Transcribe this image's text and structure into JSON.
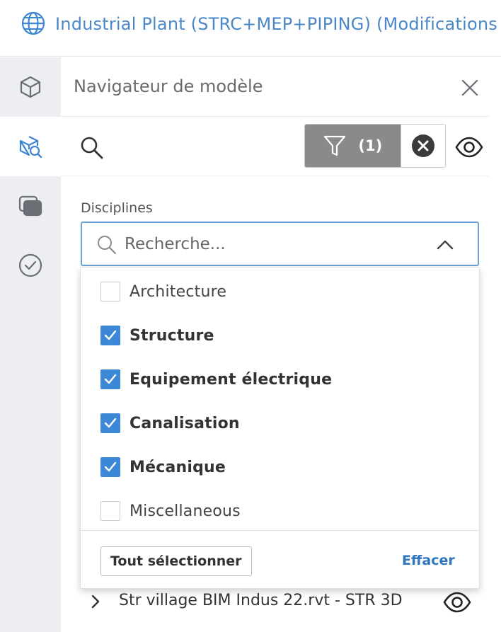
{
  "header": {
    "title": "Industrial Plant (STRC+MEP+PIPING) (Modifications no",
    "icon": "globe-icon"
  },
  "rail": {
    "items": [
      {
        "name": "model-icon",
        "active": false
      },
      {
        "name": "model-browser-icon",
        "active": true
      },
      {
        "name": "layers-icon",
        "active": false
      },
      {
        "name": "check-circle-icon",
        "active": false
      }
    ]
  },
  "panel": {
    "title": "Navigateur de modèle",
    "filter_count": "(1)"
  },
  "disciplines": {
    "label": "Disciplines",
    "placeholder": "Recherche...",
    "options": [
      {
        "label": "Architecture",
        "checked": false
      },
      {
        "label": "Structure",
        "checked": true
      },
      {
        "label": "Equipement électrique",
        "checked": true
      },
      {
        "label": "Canalisation",
        "checked": true
      },
      {
        "label": "Mécanique",
        "checked": true
      },
      {
        "label": "Miscellaneous",
        "checked": false
      }
    ],
    "select_all": "Tout sélectionner",
    "clear": "Effacer"
  },
  "tree": {
    "items": [
      {
        "label": "Str village BIM Indus 22.rvt - STR 3D"
      }
    ]
  },
  "colors": {
    "accent": "#3c88d6",
    "link": "#2f75c0",
    "header_text": "#4a87c9",
    "filter_active": "#8a8a8a"
  }
}
